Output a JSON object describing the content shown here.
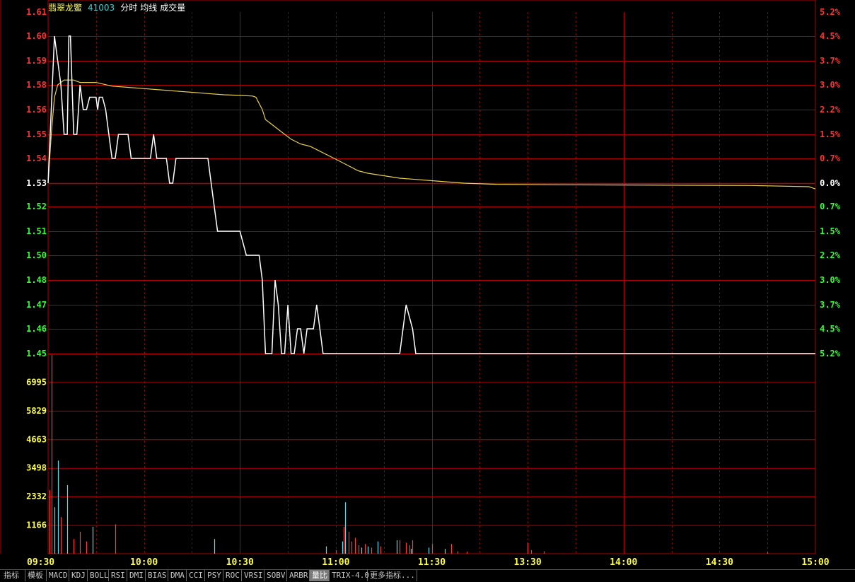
{
  "header": {
    "name": "翡翠龙鳖",
    "code": "41003",
    "mode": "分时",
    "avg_label": "均线",
    "vol_label": "成交量"
  },
  "colors": {
    "background": "#000000",
    "grid": "#b00000",
    "price_line": "#ffffff",
    "avg_line": "#e8d048",
    "up": "#ff3232",
    "down": "#32ff32",
    "neutral": "#ffffff",
    "vol_axis": "#ffff40",
    "time_axis": "#ffff40",
    "vol_up": "#ff3c3c",
    "vol_down": "#50e0f0",
    "header_name": "#ffff60",
    "header_code": "#40d0d0",
    "header_text": "#ffffff"
  },
  "toolbar": {
    "buttons": [
      "指标",
      "模板",
      "MACD",
      "KDJ",
      "BOLL",
      "RSI",
      "DMI",
      "BIAS",
      "DMA",
      "CCI",
      "PSY",
      "ROC",
      "VRSI",
      "SOBV",
      "ARBR",
      "量比",
      "TRIX-4.0",
      "更多指标..."
    ],
    "active_index": 15
  },
  "chart_data": [
    {
      "type": "line",
      "title": "分时",
      "reference_price": 1.53,
      "ylim": [
        1.45,
        1.61
      ],
      "y_ticks": [
        "1.61",
        "1.60",
        "1.59",
        "1.58",
        "1.56",
        "1.55",
        "1.54",
        "1.53",
        "1.52",
        "1.51",
        "1.50",
        "1.48",
        "1.47",
        "1.46",
        "1.45"
      ],
      "y_tick_values": [
        1.61,
        1.6,
        1.59,
        1.58,
        1.56,
        1.55,
        1.54,
        1.53,
        1.52,
        1.51,
        1.5,
        1.48,
        1.47,
        1.46,
        1.45
      ],
      "pct_ticks": [
        "5.2%",
        "4.5%",
        "3.7%",
        "3.0%",
        "2.2%",
        "1.5%",
        "0.7%",
        "0.0%",
        "0.7%",
        "1.5%",
        "2.2%",
        "3.0%",
        "3.7%",
        "4.5%",
        "5.2%"
      ],
      "x_ticks": [
        "09:30",
        "10:00",
        "10:30",
        "11:00",
        "11:30",
        "13:30",
        "14:00",
        "14:30",
        "15:00"
      ],
      "x_tick_minutes": [
        0,
        30,
        60,
        90,
        120,
        150,
        180,
        210,
        240
      ],
      "series": [
        {
          "name": "分时",
          "points": [
            [
              0,
              1.53
            ],
            [
              2,
              1.6
            ],
            [
              3,
              1.59
            ],
            [
              4,
              1.58
            ],
            [
              5,
              1.55
            ],
            [
              6,
              1.55
            ],
            [
              6.5,
              1.6
            ],
            [
              7,
              1.6
            ],
            [
              8,
              1.55
            ],
            [
              9,
              1.55
            ],
            [
              10,
              1.58
            ],
            [
              11,
              1.56
            ],
            [
              12,
              1.56
            ],
            [
              13,
              1.57
            ],
            [
              14,
              1.57
            ],
            [
              15,
              1.57
            ],
            [
              15.5,
              1.56
            ],
            [
              16,
              1.57
            ],
            [
              17,
              1.57
            ],
            [
              18,
              1.56
            ],
            [
              19,
              1.55
            ],
            [
              20,
              1.54
            ],
            [
              21,
              1.54
            ],
            [
              22,
              1.55
            ],
            [
              24,
              1.55
            ],
            [
              25,
              1.55
            ],
            [
              26,
              1.54
            ],
            [
              29,
              1.54
            ],
            [
              32,
              1.54
            ],
            [
              33,
              1.55
            ],
            [
              34,
              1.54
            ],
            [
              35,
              1.54
            ],
            [
              36,
              1.54
            ],
            [
              37,
              1.54
            ],
            [
              38,
              1.53
            ],
            [
              39,
              1.53
            ],
            [
              40,
              1.54
            ],
            [
              50,
              1.54
            ],
            [
              51,
              1.53
            ],
            [
              53,
              1.51
            ],
            [
              57,
              1.51
            ],
            [
              60,
              1.51
            ],
            [
              62,
              1.5
            ],
            [
              66,
              1.5
            ],
            [
              67,
              1.48
            ],
            [
              68,
              1.45
            ],
            [
              69,
              1.45
            ],
            [
              70,
              1.45
            ],
            [
              71,
              1.48
            ],
            [
              72,
              1.47
            ],
            [
              73,
              1.45
            ],
            [
              74,
              1.45
            ],
            [
              75,
              1.47
            ],
            [
              76,
              1.45
            ],
            [
              77,
              1.45
            ],
            [
              78,
              1.46
            ],
            [
              79,
              1.46
            ],
            [
              80,
              1.45
            ],
            [
              81,
              1.46
            ],
            [
              82,
              1.46
            ],
            [
              83,
              1.46
            ],
            [
              84,
              1.47
            ],
            [
              85,
              1.46
            ],
            [
              86,
              1.45
            ],
            [
              88,
              1.45
            ],
            [
              110,
              1.45
            ],
            [
              112,
              1.47
            ],
            [
              114,
              1.46
            ],
            [
              115,
              1.45
            ],
            [
              120,
              1.45
            ],
            [
              180,
              1.45
            ],
            [
              240,
              1.45
            ]
          ]
        },
        {
          "name": "均线",
          "points": [
            [
              0,
              1.53
            ],
            [
              1,
              1.55
            ],
            [
              2,
              1.57
            ],
            [
              3,
              1.58
            ],
            [
              5,
              1.582
            ],
            [
              8,
              1.582
            ],
            [
              10,
              1.581
            ],
            [
              15,
              1.581
            ],
            [
              20,
              1.579
            ],
            [
              25,
              1.578
            ],
            [
              30,
              1.577
            ],
            [
              35,
              1.576
            ],
            [
              40,
              1.575
            ],
            [
              45,
              1.574
            ],
            [
              50,
              1.573
            ],
            [
              55,
              1.572
            ],
            [
              60,
              1.5715
            ],
            [
              64,
              1.571
            ],
            [
              65,
              1.57
            ],
            [
              66,
              1.565
            ],
            [
              67,
              1.56
            ],
            [
              68,
              1.556
            ],
            [
              70,
              1.554
            ],
            [
              73,
              1.551
            ],
            [
              76,
              1.548
            ],
            [
              79,
              1.546
            ],
            [
              82,
              1.545
            ],
            [
              85,
              1.543
            ],
            [
              88,
              1.541
            ],
            [
              91,
              1.539
            ],
            [
              94,
              1.537
            ],
            [
              97,
              1.535
            ],
            [
              100,
              1.534
            ],
            [
              105,
              1.533
            ],
            [
              110,
              1.532
            ],
            [
              115,
              1.5315
            ],
            [
              120,
              1.531
            ],
            [
              130,
              1.53
            ],
            [
              140,
              1.5295
            ],
            [
              160,
              1.5293
            ],
            [
              180,
              1.5292
            ],
            [
              200,
              1.5291
            ],
            [
              220,
              1.529
            ],
            [
              238,
              1.5285
            ],
            [
              240,
              1.5275
            ]
          ]
        }
      ]
    },
    {
      "type": "bar",
      "title": "成交量",
      "ylim": [
        0,
        8161
      ],
      "y_ticks": [
        "6995",
        "5829",
        "4663",
        "3498",
        "2332",
        "1166"
      ],
      "y_tick_values": [
        6995,
        5829,
        4663,
        3498,
        2332,
        1166
      ],
      "bars": [
        {
          "t": 1,
          "v": 8100,
          "dir": "up"
        },
        {
          "t": 0.5,
          "v": 2600,
          "dir": "up"
        },
        {
          "t": 2,
          "v": 1900,
          "dir": "down"
        },
        {
          "t": 3,
          "v": 3800,
          "dir": "down"
        },
        {
          "t": 4,
          "v": 1500,
          "dir": "up"
        },
        {
          "t": 6,
          "v": 2800,
          "dir": "down"
        },
        {
          "t": 8,
          "v": 600,
          "dir": "up"
        },
        {
          "t": 10,
          "v": 900,
          "dir": "up"
        },
        {
          "t": 12,
          "v": 500,
          "dir": "up"
        },
        {
          "t": 14,
          "v": 1100,
          "dir": "down"
        },
        {
          "t": 21,
          "v": 1200,
          "dir": "up"
        },
        {
          "t": 52,
          "v": 600,
          "dir": "down"
        },
        {
          "t": 87,
          "v": 300,
          "dir": "down"
        },
        {
          "t": 90,
          "v": 150,
          "dir": "up"
        },
        {
          "t": 92,
          "v": 500,
          "dir": "down"
        },
        {
          "t": 92.5,
          "v": 1100,
          "dir": "up"
        },
        {
          "t": 93,
          "v": 2100,
          "dir": "down"
        },
        {
          "t": 94,
          "v": 900,
          "dir": "up"
        },
        {
          "t": 95,
          "v": 500,
          "dir": "up"
        },
        {
          "t": 96,
          "v": 650,
          "dir": "up"
        },
        {
          "t": 97,
          "v": 350,
          "dir": "up"
        },
        {
          "t": 98,
          "v": 250,
          "dir": "down"
        },
        {
          "t": 99,
          "v": 400,
          "dir": "up"
        },
        {
          "t": 100,
          "v": 300,
          "dir": "down"
        },
        {
          "t": 101,
          "v": 250,
          "dir": "up"
        },
        {
          "t": 103,
          "v": 500,
          "dir": "down"
        },
        {
          "t": 104,
          "v": 300,
          "dir": "up"
        },
        {
          "t": 109,
          "v": 550,
          "dir": "down"
        },
        {
          "t": 110,
          "v": 550,
          "dir": "up"
        },
        {
          "t": 112,
          "v": 450,
          "dir": "up"
        },
        {
          "t": 113,
          "v": 350,
          "dir": "up"
        },
        {
          "t": 113.5,
          "v": 200,
          "dir": "down"
        },
        {
          "t": 114,
          "v": 550,
          "dir": "up"
        },
        {
          "t": 119,
          "v": 250,
          "dir": "down"
        },
        {
          "t": 120,
          "v": 400,
          "dir": "up"
        },
        {
          "t": 124,
          "v": 200,
          "dir": "down"
        },
        {
          "t": 126,
          "v": 400,
          "dir": "up"
        },
        {
          "t": 128,
          "v": 100,
          "dir": "up"
        },
        {
          "t": 131,
          "v": 80,
          "dir": "up"
        },
        {
          "t": 150,
          "v": 450,
          "dir": "up"
        },
        {
          "t": 151,
          "v": 150,
          "dir": "up"
        },
        {
          "t": 155,
          "v": 100,
          "dir": "up"
        },
        {
          "t": 225,
          "v": 60,
          "dir": "up"
        }
      ]
    }
  ]
}
